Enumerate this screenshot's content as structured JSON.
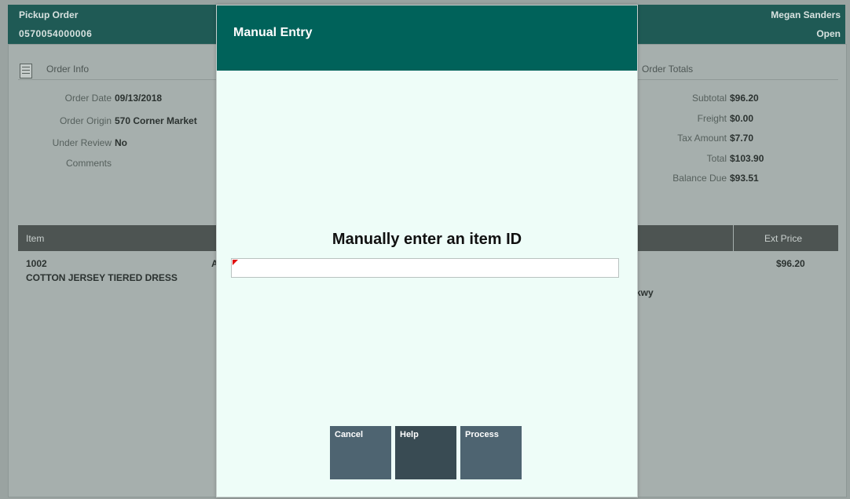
{
  "header": {
    "title": "Pickup Order",
    "order_number": "0570054000006",
    "user": "Megan Sanders",
    "status": "Open"
  },
  "order_info": {
    "title": "Order Info",
    "icon": "document-icon",
    "order_date_label": "Order Date",
    "order_date": "09/13/2018",
    "order_origin_label": "Order Origin",
    "order_origin": "570 Corner Market",
    "under_review_label": "Under Review",
    "under_review": "No",
    "comments_label": "Comments"
  },
  "order_totals": {
    "title": "Order Totals",
    "subtotal_label": "Subtotal",
    "subtotal": "$96.20",
    "freight_label": "Freight",
    "freight": "$0.00",
    "tax_label": "Tax Amount",
    "tax": "$7.70",
    "total_label": "Total",
    "total": "$103.90",
    "balance_label": "Balance Due",
    "balance": "$93.51"
  },
  "table": {
    "col_item": "Item",
    "col_ext_price": "Ext Price",
    "row": {
      "item_id": "1002",
      "description": "COTTON JERSEY TIERED DRESS",
      "ext_price": "$96.20",
      "partial_a": "A",
      "partial_addr": "kwy"
    }
  },
  "modal": {
    "title": "Manual Entry",
    "prompt": "Manually enter an item ID",
    "input_value": "",
    "buttons": {
      "cancel": "Cancel",
      "help": "Help",
      "process": "Process"
    }
  },
  "colors": {
    "modal_header": "#00625a",
    "modal_body": "#eefdf8",
    "button": "#4e6471",
    "button_dark": "#394b53",
    "required_flag": "#e01010"
  }
}
